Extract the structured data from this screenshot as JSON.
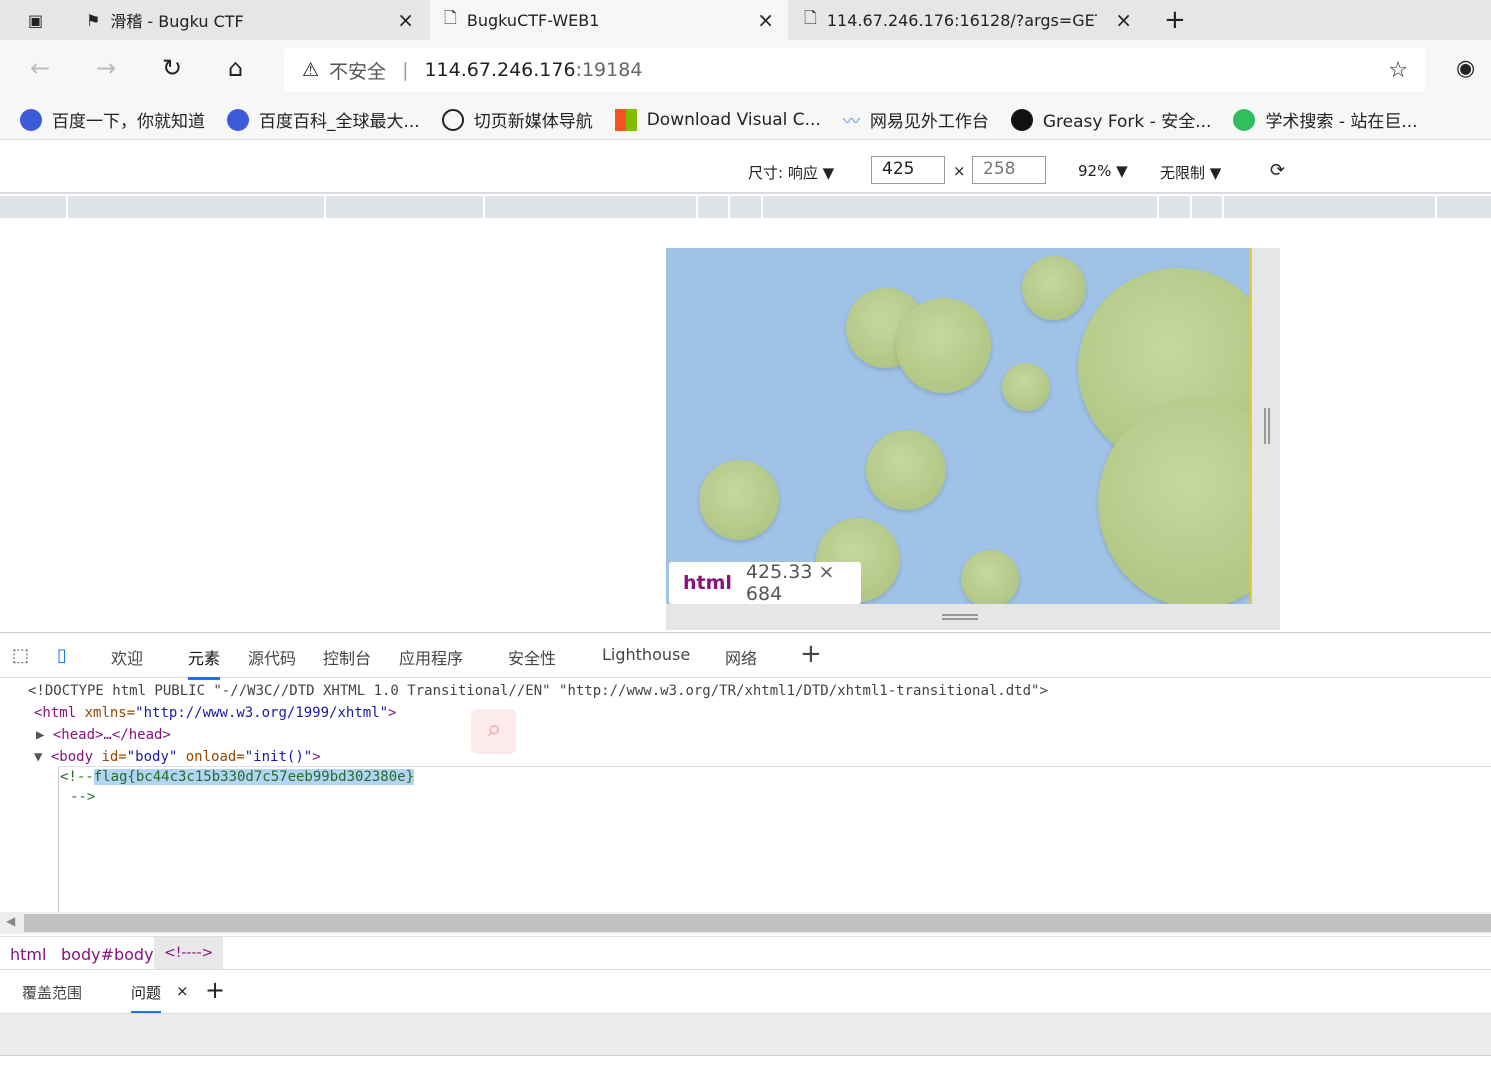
{
  "tabs": [
    {
      "title": "滑稽 - Bugku CTF"
    },
    {
      "title": "BugkuCTF-WEB1"
    },
    {
      "title": "114.67.246.176:16128/?args=GET"
    }
  ],
  "address": {
    "security": "不安全",
    "host": "114.67.246.176",
    "port": ":19184"
  },
  "bookmarks": [
    {
      "label": "百度一下，你就知道",
      "color": "#3b5bdb"
    },
    {
      "label": "百度百科_全球最大...",
      "color": "#3b5bdb"
    },
    {
      "label": "切页新媒体导航",
      "color": "#222"
    },
    {
      "label": "Download Visual C...",
      "color": "#f35325"
    },
    {
      "label": "网易见外工作台",
      "color": "#5aa0e6"
    },
    {
      "label": "Greasy Fork - 安全...",
      "color": "#111"
    },
    {
      "label": "学术搜索 - 站在巨...",
      "color": "#2fbf5f"
    }
  ],
  "device": {
    "size_label": "尺寸: 响应",
    "width": "425",
    "height": "258",
    "times": "×",
    "zoom": "92%",
    "throttle": "无限制"
  },
  "tooltip": {
    "tag": "html",
    "dims": "425.33 × 684"
  },
  "devtools_tabs": [
    "欢迎",
    "元素",
    "源代码",
    "控制台",
    "应用程序",
    "安全性",
    "Lighthouse",
    "网络"
  ],
  "code": {
    "doctype": "<!DOCTYPE html PUBLIC \"-//W3C//DTD XHTML 1.0 Transitional//EN\" \"http://www.w3.org/TR/xhtml1/DTD/xhtml1-transitional.dtd\">",
    "html_open": "<html",
    "html_attr": " xmlns=",
    "html_val": "\"http://www.w3.org/1999/xhtml\"",
    "head": "<head>…</head>",
    "body_open": "<body",
    "body_attr1": " id=",
    "body_val1": "\"body\"",
    "body_attr2": " onload=",
    "body_val2": "\"init()\"",
    "comment_start": "<!--",
    "flag": "flag{bc44c3c15b330d7c57eeb99bd302380e}",
    "comment_end": "-->"
  },
  "breadcrumbs": [
    "html",
    "body#body",
    "<!---->"
  ],
  "drawer_tabs": [
    "覆盖范围",
    "问题"
  ]
}
